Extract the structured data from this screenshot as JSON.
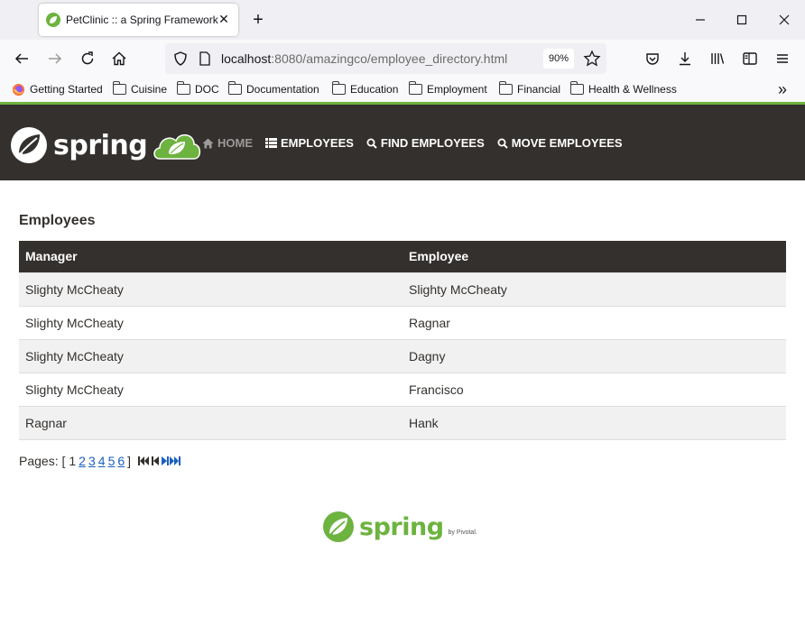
{
  "browser": {
    "tab_title": "PetClinic :: a Spring Framework demonstration",
    "tab_close": "✕",
    "new_tab": "+",
    "url_host": "localhost",
    "url_rest": ":8080/amazingco/employee_directory.html",
    "zoom": "90%",
    "bookmarks": [
      "Getting Started",
      "Cuisine",
      "DOC",
      "Documentation",
      "Education",
      "Employment",
      "Financial",
      "Health & Wellness"
    ],
    "overflow": "»"
  },
  "header": {
    "brand": "spring",
    "menu": {
      "home": "HOME",
      "employees": "EMPLOYEES",
      "find": "FIND EMPLOYEES",
      "move": "MOVE EMPLOYEES"
    }
  },
  "main": {
    "title": "Employees",
    "columns": [
      "Manager",
      "Employee"
    ],
    "rows": [
      [
        "Slighty McCheaty",
        "Slighty McCheaty"
      ],
      [
        "Slighty McCheaty",
        "Ragnar"
      ],
      [
        "Slighty McCheaty",
        "Dagny"
      ],
      [
        "Slighty McCheaty",
        "Francisco"
      ],
      [
        "Ragnar",
        "Hank"
      ]
    ],
    "pager": {
      "label": "Pages: [",
      "current": "1",
      "pages": [
        "2",
        "3",
        "4",
        "5",
        "6"
      ],
      "close": "]"
    }
  },
  "footer": {
    "brand": "spring",
    "by": "by Pivotal."
  },
  "colors": {
    "spring_green": "#6db33f",
    "header_dark": "#34302d",
    "link_blue": "#1a5fbe"
  },
  "icons": [
    "leaf-icon",
    "home-icon",
    "list-icon",
    "search-icon",
    "folder-icon",
    "first-page-icon",
    "prev-page-icon",
    "next-page-icon",
    "last-page-icon"
  ]
}
